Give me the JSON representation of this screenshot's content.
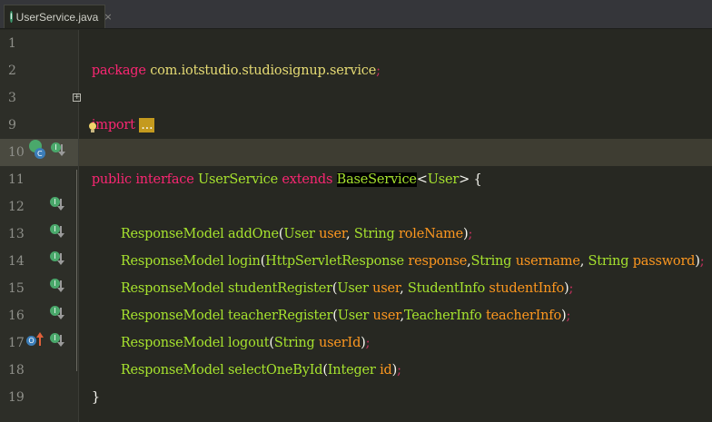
{
  "tab": {
    "label": "UserService.java",
    "icon": "interface-icon",
    "close": "×"
  },
  "lines": [
    {
      "no": "1"
    },
    {
      "no": "2"
    },
    {
      "no": "3"
    },
    {
      "no": "9"
    },
    {
      "no": "10"
    },
    {
      "no": "11"
    },
    {
      "no": "12"
    },
    {
      "no": "13"
    },
    {
      "no": "14"
    },
    {
      "no": "15"
    },
    {
      "no": "16"
    },
    {
      "no": "17"
    },
    {
      "no": "18"
    },
    {
      "no": "19"
    }
  ],
  "code": {
    "package_kw": "package",
    "package_name": " com.iotstudio.studiosignup.service",
    "semi": ";",
    "import_kw": "import",
    "import_fold": "...",
    "l10": {
      "public": "public",
      "interface": "interface",
      "name": "UserService",
      "extends": "extends",
      "base": "BaseService",
      "lt": "<",
      "generic": "User",
      "gt": ">",
      "brace": "{"
    },
    "methods": [
      {
        "ret": "ResponseModel",
        "name": "addOne",
        "open": "(",
        "t1": "User",
        "p1": "user",
        "sep": ", ",
        "t2": "String",
        "p2": "roleName",
        "t3": "",
        "p3": "",
        "close": ")"
      },
      {
        "ret": "ResponseModel",
        "name": "login",
        "open": "(",
        "t1": "HttpServletResponse",
        "p1": "response",
        "sep": ",",
        "t2": "String",
        "p2": "username",
        "sep2": ", ",
        "t3": "String",
        "p3": "password",
        "close": ")"
      },
      {
        "ret": "ResponseModel",
        "name": "studentRegister",
        "open": "(",
        "t1": "User",
        "p1": "user",
        "sep": ", ",
        "t2": "StudentInfo",
        "p2": "studentInfo",
        "close": ")"
      },
      {
        "ret": "ResponseModel",
        "name": "teacherRegister",
        "open": "(",
        "t1": "User",
        "p1": "user",
        "sep": ",",
        "t2": "TeacherInfo",
        "p2": "teacherInfo",
        "close": ")"
      },
      {
        "ret": "ResponseModel",
        "name": "logout",
        "open": "(",
        "t1": "String",
        "p1": "userId",
        "close": ")"
      },
      {
        "ret": "ResponseModel",
        "name": "selectOneById",
        "open": "(",
        "t1": "Integer",
        "p1": "id",
        "close": ")"
      }
    ],
    "end_brace": "}"
  },
  "colors": {
    "bg": "#272822",
    "keyword": "#f92672",
    "type": "#a6e22e",
    "param": "#fd971f",
    "package": "#e6db74",
    "highlight_line": "#3e3d32"
  }
}
